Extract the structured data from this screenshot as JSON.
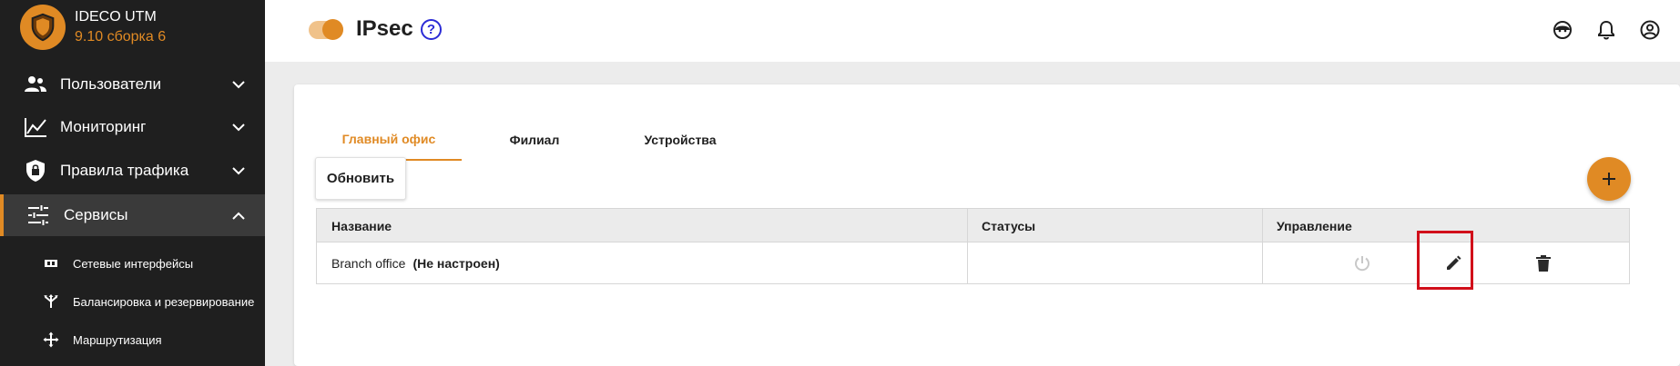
{
  "brand": {
    "name": "IDECO UTM",
    "version": "9.10 сборка 6"
  },
  "sidebar": {
    "items": [
      {
        "label": "Пользователи",
        "icon": "users-icon"
      },
      {
        "label": "Мониторинг",
        "icon": "chart-icon"
      },
      {
        "label": "Правила трафика",
        "icon": "shield-lock-icon"
      },
      {
        "label": "Сервисы",
        "icon": "tune-icon"
      }
    ],
    "sub_items": [
      {
        "label": "Сетевые интерфейсы",
        "icon": "network-card-icon"
      },
      {
        "label": "Балансировка и резервирование",
        "icon": "split-arrows-icon"
      },
      {
        "label": "Маршрутизация",
        "icon": "move-arrows-icon"
      }
    ]
  },
  "header": {
    "title": "IPsec",
    "help": "?"
  },
  "tabs": [
    {
      "label": "Главный офис",
      "active": true
    },
    {
      "label": "Филиал",
      "active": false
    },
    {
      "label": "Устройства",
      "active": false
    }
  ],
  "toolbar": {
    "refresh_label": "Обновить",
    "add_label": "+"
  },
  "table": {
    "columns": [
      "Название",
      "Статусы",
      "Управление"
    ],
    "rows": [
      {
        "name": "Branch office",
        "status_note": "(Не настроен)",
        "status": ""
      }
    ]
  },
  "colors": {
    "accent": "#e08a24",
    "sidebar_bg": "#1f1f1f",
    "highlight": "#d10f1a"
  }
}
